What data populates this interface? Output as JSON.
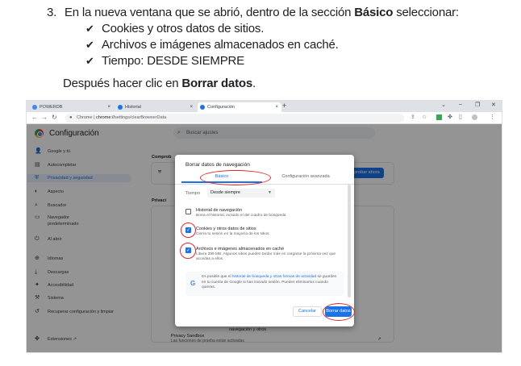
{
  "instructions": {
    "step_number": "3.",
    "step_text_before": "En la nueva ventana que se abrió, dentro de la sección ",
    "step_text_bold": "Básico",
    "step_text_after": " seleccionar:",
    "check_icon": "check-mark-icon",
    "bullets": [
      "Cookies y otros datos de sitios.",
      "Archivos e imágenes almacenados en caché.",
      "Tiempo: DESDE SIEMPRE"
    ],
    "after_before": "Después hacer clic en ",
    "after_bold": "Borrar datos",
    "after_end": "."
  },
  "browser": {
    "tabs": [
      {
        "label": "POWERDB",
        "active": false
      },
      {
        "label": "Historial",
        "active": false
      },
      {
        "label": "Configuración",
        "active": true
      }
    ],
    "new_tab": "+",
    "url_prefix": "Chrome | ",
    "url_host": "chrome://",
    "url_path": "settings/clearBrowserData"
  },
  "settings": {
    "title": "Configuración",
    "search_placeholder": "Buscar ajustes",
    "sidebar": [
      {
        "label": "Google y tú",
        "icon": "person-icon",
        "glyph": "👤"
      },
      {
        "label": "Autocompletar",
        "icon": "clipboard-icon",
        "glyph": "▤"
      },
      {
        "label": "Privacidad y seguridad",
        "icon": "shield-icon",
        "glyph": "⛨"
      },
      {
        "label": "Aspecto",
        "icon": "palette-icon",
        "glyph": "◐"
      },
      {
        "label": "Buscador",
        "icon": "search-icon",
        "glyph": "⌕"
      },
      {
        "label": "Navegador predeterminado",
        "icon": "browser-icon",
        "glyph": "▭"
      },
      {
        "label": "Al abrir",
        "icon": "power-icon",
        "glyph": "⏻"
      },
      {
        "label": "Idiomas",
        "icon": "globe-icon",
        "glyph": "⊕"
      },
      {
        "label": "Descargas",
        "icon": "download-icon",
        "glyph": "⤓"
      },
      {
        "label": "Accesibilidad",
        "icon": "accessibility-icon",
        "glyph": "✦"
      },
      {
        "label": "Sistema",
        "icon": "wrench-icon",
        "glyph": "⚒"
      },
      {
        "label": "Recuperar configuración y limpiar",
        "icon": "history-icon",
        "glyph": "↺"
      },
      {
        "label": "Extensiones",
        "icon": "puzzle-icon",
        "glyph": "✤"
      }
    ],
    "check_label": "Comprob",
    "check_button": "probar ahora",
    "privacy_label": "Privaci",
    "bottom_row_title": "Privacy Sandbox",
    "bottom_row_sub": "Las funciones de prueba están activadas",
    "row_partial": "navegación y otros"
  },
  "dialog": {
    "title": "Borrar datos de navegación",
    "tab_basic": "Básico",
    "tab_advanced": "Configuración avanzada",
    "time_label": "Tiempo",
    "time_value": "Desde siempre",
    "options": [
      {
        "title": "Historial de navegación",
        "desc": "Borra el historial, incluido el del cuadro de búsqueda",
        "checked": false
      },
      {
        "title": "Cookies y otros datos de sitios",
        "desc": "Cierra tu sesión en la mayoría de los sitios.",
        "checked": true
      },
      {
        "title": "Archivos e imágenes almacenados en caché",
        "desc": "Libera 399 MB. Algunos sitios pueden tardar más en cargarse la próxima vez que accedas a ellos.",
        "checked": true
      }
    ],
    "notice_pre": "Es posible que el ",
    "notice_link": "historial de búsqueda y otras formas de actividad",
    "notice_post": " se guarden en tu cuenta de Google si has iniciado sesión. Puedes eliminarlos cuando quieras.",
    "cancel": "Cancelar",
    "clear": "Borrar datos"
  },
  "colors": {
    "accent": "#1a73e8",
    "annotation": "#e3262a"
  }
}
